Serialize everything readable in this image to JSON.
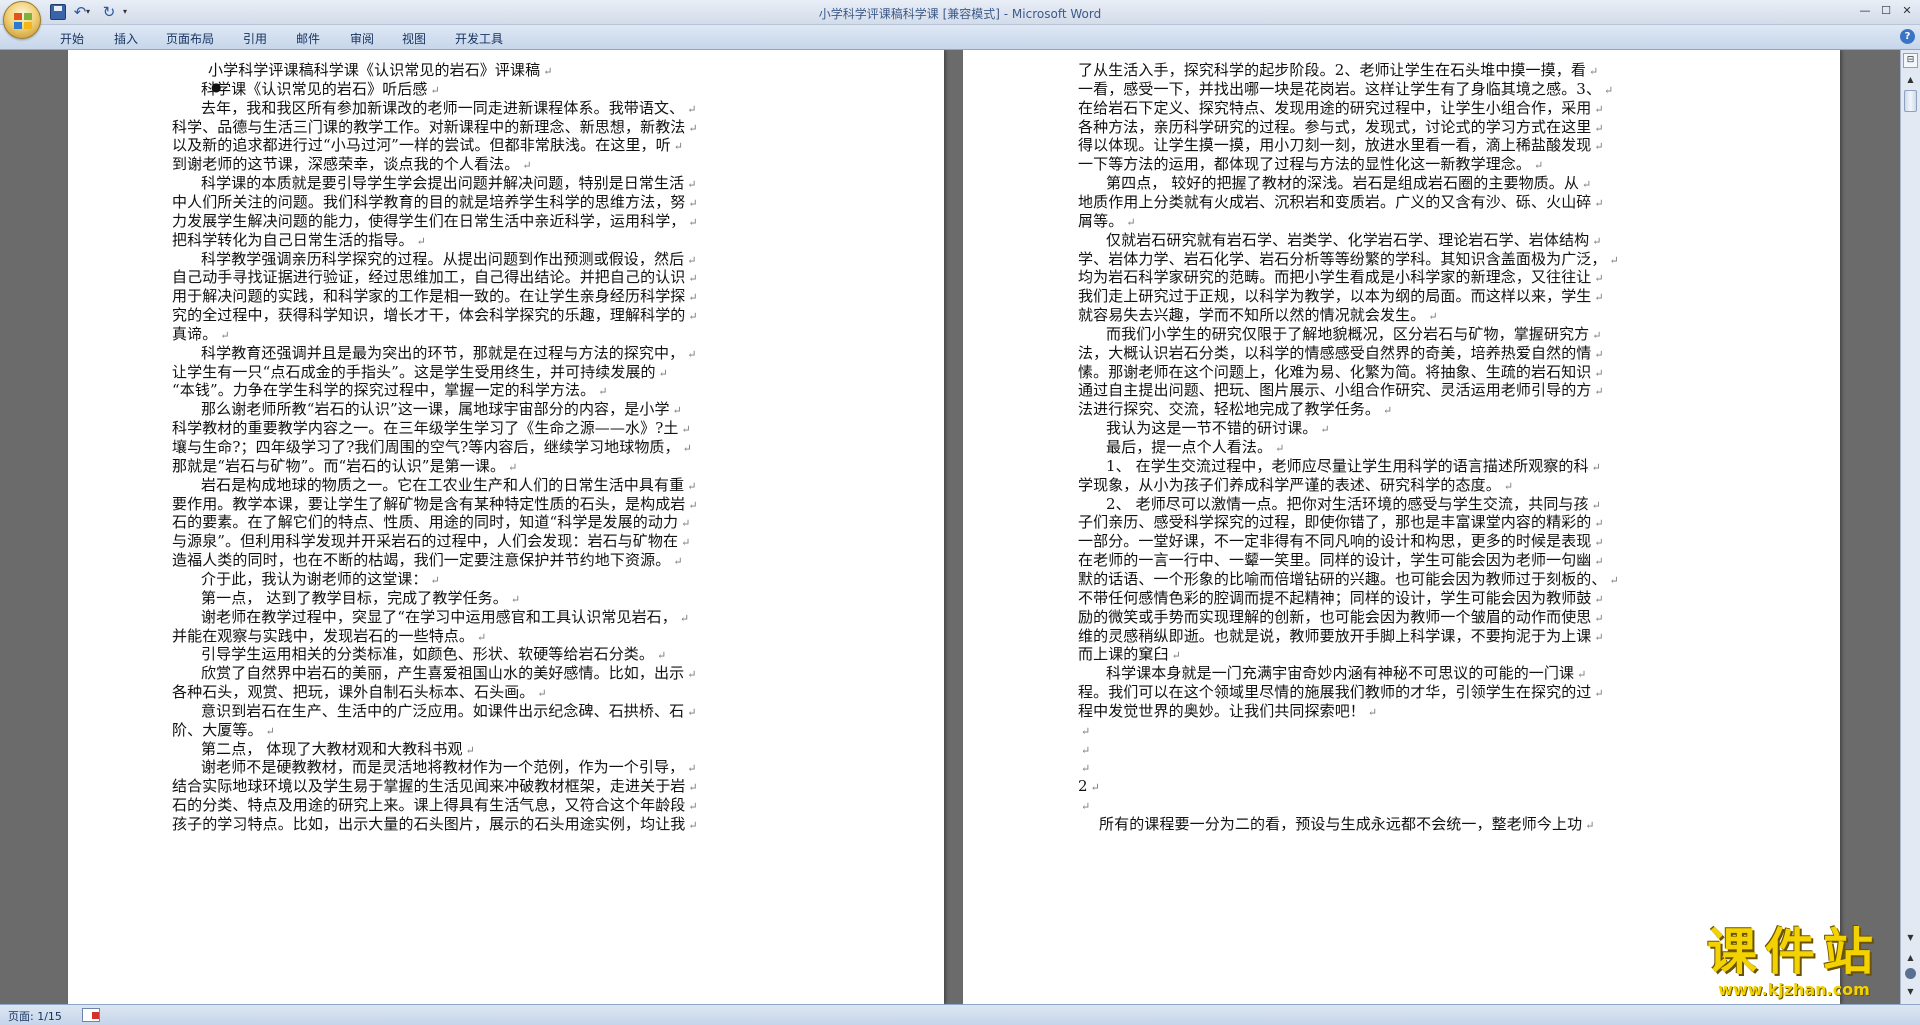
{
  "window": {
    "title": "小学科学评课稿科学课 [兼容模式] - Microsoft Word",
    "buttons": {
      "minimize": "—",
      "maximize": "☐",
      "close": "✕"
    }
  },
  "quick_access": {
    "save_icon": "save-icon",
    "undo": "↶",
    "undo_dropdown": "▾",
    "redo": "↻",
    "customize": "▾"
  },
  "ribbon": {
    "tabs": [
      "开始",
      "插入",
      "页面布局",
      "引用",
      "邮件",
      "审阅",
      "视图",
      "开发工具"
    ],
    "help": "?"
  },
  "pilcrow": "↵",
  "cursor_mark": "|",
  "document": {
    "page1_lines": [
      "小学科学评课稿科学课《认识常见的岩石》评课稿",
      "科学课《认识常见的岩石》听后感",
      "去年，我和我区所有参加新课改的老师一同走进新课程体系。我带语文、",
      "科学、品德与生活三门课的教学工作。对新课程中的新理念、新思想，新教法",
      "以及新的追求都进行过“小马过河”一样的尝试。但都非常肤浅。在这里，听",
      "到谢老师的这节课，深感荣幸，谈点我的个人看法。",
      "科学课的本质就是要引导学生学会提出问题并解决问题，特别是日常生活",
      "中人们所关注的问题。我们科学教育的目的就是培养学生科学的思维方法，努",
      "力发展学生解决问题的能力，使得学生们在日常生活中亲近科学，运用科学，",
      "把科学转化为自己日常生活的指导。",
      "科学教学强调亲历科学探究的过程。从提出问题到作出预测或假设，然后",
      "自己动手寻找证据进行验证，经过思维加工，自己得出结论。并把自己的认识",
      "用于解决问题的实践，和科学家的工作是相一致的。在让学生亲身经历科学探",
      "究的全过程中，获得科学知识，增长才干，体会科学探究的乐趣，理解科学的",
      "真谛。",
      "科学教育还强调并且是最为突出的环节，那就是在过程与方法的探究中，",
      "让学生有一只“点石成金的手指头”。这是学生受用终生，并可持续发展的",
      "“本钱”。力争在学生科学的探究过程中，掌握一定的科学方法。",
      "那么谢老师所教“岩石的认识”这一课，属地球宇宙部分的内容，是小学",
      "科学教材的重要教学内容之一。在三年级学生学习了《生命之源——水》?土",
      "壤与生命?；四年级学习了?我们周围的空气?等内容后，继续学习地球物质，",
      "那就是“岩石与矿物”。而“岩石的认识”是第一课。",
      "岩石是构成地球的物质之一。它在工农业生产和人们的日常生活中具有重",
      "要作用。教学本课，要让学生了解矿物是含有某种特定性质的石头，是构成岩",
      "石的要素。在了解它们的特点、性质、用途的同时，知道“科学是发展的动力",
      "与源泉”。但利用科学发现并开采岩石的过程中，人们会发现：岩石与矿物在",
      "造福人类的同时，也在不断的枯竭，我们一定要注意保护并节约地下资源。",
      "介于此，我认为谢老师的这堂课：",
      "第一点，  达到了教学目标，完成了教学任务。",
      "谢老师在教学过程中，突显了“在学习中运用感官和工具认识常见岩石，",
      "并能在观察与实践中，发现岩石的一些特点。",
      "引导学生运用相关的分类标准，如颜色、形状、软硬等给岩石分类。",
      "欣赏了自然界中岩石的美丽，产生喜爱祖国山水的美好感情。比如，出示",
      "各种石头，观赏、把玩，课外自制石头标本、石头画。",
      "意识到岩石在生产、生活中的广泛应用。如课件出示纪念碑、石拱桥、石",
      "阶、大厦等。",
      "第二点，  体现了大教材观和大教科书观",
      "谢老师不是硬教教材，而是灵活地将教材作为一个范例，作为一个引导，",
      "结合实际地球环境以及学生易于掌握的生活见闻来冲破教材框架，走进关于岩",
      "石的分类、特点及用途的研究上来。课上得具有生活气息，又符合这个年龄段",
      "孩子的学习特点。比如，出示大量的石头图片，展示的石头用途实例，均让我"
    ],
    "page2_lines": [
      "了从生活入手，探究科学的起步阶段。2、老师让学生在石头堆中摸一摸，看",
      "一看，感受一下，并找出哪一块是花岗岩。这样让学生有了身临其境之感。3、",
      "在给岩石下定义、探究特点、发现用途的研究过程中，让学生小组合作，采用",
      "各种方法，亲历科学研究的过程。参与式，发现式，讨论式的学习方式在这里",
      "得以体现。让学生摸一摸，用小刀刻一刻，放进水里看一看，滴上稀盐酸发现",
      "一下等方法的运用，都体现了过程与方法的显性化这一新教学理念。",
      "第四点，  较好的把握了教材的深浅。岩石是组成岩石圈的主要物质。从",
      "地质作用上分类就有火成岩、沉积岩和变质岩。广义的又含有沙、砾、火山碎",
      "屑等。",
      "仅就岩石研究就有岩石学、岩类学、化学岩石学、理论岩石学、岩体结构",
      "学、岩体力学、岩石化学、岩石分析等等纷繁的学科。其知识含盖面极为广泛，",
      "均为岩石科学家研究的范畴。而把小学生看成是小科学家的新理念，又往往让",
      "我们走上研究过于正规，以科学为教学，以本为纲的局面。而这样以来，学生",
      "就容易失去兴趣，学而不知所以然的情况就会发生。",
      "而我们小学生的研究仅限于了解地貌概况，区分岩石与矿物，掌握研究方",
      "法，大概认识岩石分类，以科学的情感感受自然界的奇美，培养热爱自然的情",
      "愫。那谢老师在这个问题上，化难为易、化繁为简。将抽象、生疏的岩石知识",
      "通过自主提出问题、把玩、图片展示、小组合作研究、灵活运用老师引导的方",
      "法进行探究、交流，轻松地完成了教学任务。",
      "我认为这是一节不错的研讨课。",
      "最后，提一点个人看法。",
      "1、  在学生交流过程中，老师应尽量让学生用科学的语言描述所观察的科",
      "学现象，从小为孩子们养成科学严谨的表述、研究科学的态度。",
      "2、  老师尽可以激情一点。把你对生活环境的感受与学生交流，共同与孩",
      "子们亲历、感受科学探究的过程，即使你错了，那也是丰富课堂内容的精彩的",
      "一部分。一堂好课，不一定非得有不同凡响的设计和构思，更多的时候是表现",
      "在老师的一言一行中、一颦一笑里。同样的设计，学生可能会因为老师一句幽",
      "默的话语、一个形象的比喻而倍增钻研的兴趣。也可能会因为教师过于刻板的、",
      "不带任何感情色彩的腔调而提不起精神；同样的设计，学生可能会因为教师鼓",
      "励的微笑或手势而实现理解的创新，也可能会因为教师一个皱眉的动作而使思",
      "维的灵感稍纵即逝。也就是说，教师要放开手脚上科学课，不要拘泥于为上课",
      "而上课的窠臼",
      "科学课本身就是一门充满宇宙奇妙内涵有神秘不可思议的可能的一门课",
      "程。我们可以在这个领域里尽情的施展我们教师的才华，引领学生在探究的过",
      "程中发觉世界的奥妙。让我们共同探索吧！",
      "",
      "",
      "",
      "2",
      "",
      "所有的课程要一分为二的看，预设与生成永远都不会统一，整老师今上功"
    ]
  },
  "status": {
    "page": "页面: 1/15",
    "proofing_icon": "proofing-icon"
  },
  "watermark": {
    "brand": "课件站",
    "url": "www.kjzhan.com"
  },
  "colors": {
    "workspace": "#6b6b6b",
    "ribbon": "#c7d6ea",
    "title_text": "#3d5a8a",
    "watermark": "#f2d200"
  }
}
